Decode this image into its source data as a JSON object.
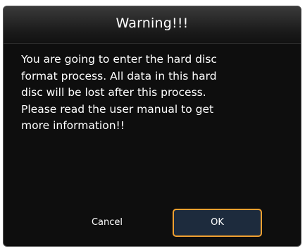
{
  "dialog": {
    "title": "Warning!!!",
    "message_lines": [
      "You are going to enter the hard disc",
      "format process. All data in this hard",
      "disc will be lost after this process.",
      "Please read the user manual to get",
      "more information!!"
    ],
    "buttons": {
      "cancel_label": "Cancel",
      "ok_label": "OK"
    }
  },
  "colors": {
    "background": "#0e0e0e",
    "title_bar": "#2a2a2a",
    "ok_border": "#f0a030",
    "ok_fill": "#1d2b3d",
    "text": "#ffffff"
  }
}
